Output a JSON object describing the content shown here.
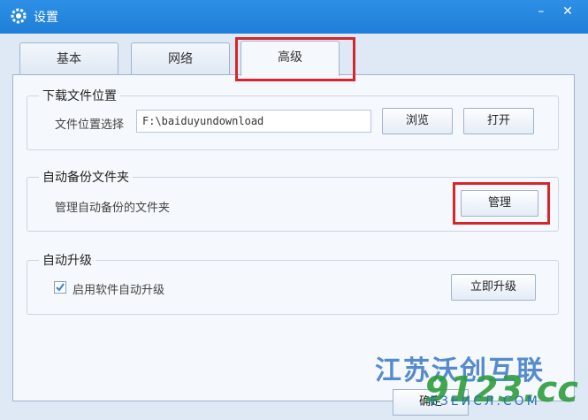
{
  "window": {
    "title": "设置"
  },
  "tabs": [
    {
      "label": "基本"
    },
    {
      "label": "网络"
    },
    {
      "label": "高级"
    }
  ],
  "download": {
    "title": "下载文件位置",
    "label": "文件位置选择",
    "path": "F:\\baiduyundownload",
    "browse": "浏览",
    "open": "打开"
  },
  "backup": {
    "title": "自动备份文件夹",
    "label": "管理自动备份的文件夹",
    "manage": "管理"
  },
  "upgrade": {
    "title": "自动升级",
    "checkbox_label": "启用软件自动升级",
    "checked": true,
    "now": "立即升级"
  },
  "footer": {
    "ok": "确定"
  },
  "watermark": {
    "line1": "江苏沃创互联",
    "line2": "9123.cc",
    "line3": "ЕЗЕИСЛ.СОМ"
  },
  "colors": {
    "titlebar": "#2d8fe6",
    "highlight": "#d8252b",
    "check": "#3b7dd8"
  }
}
